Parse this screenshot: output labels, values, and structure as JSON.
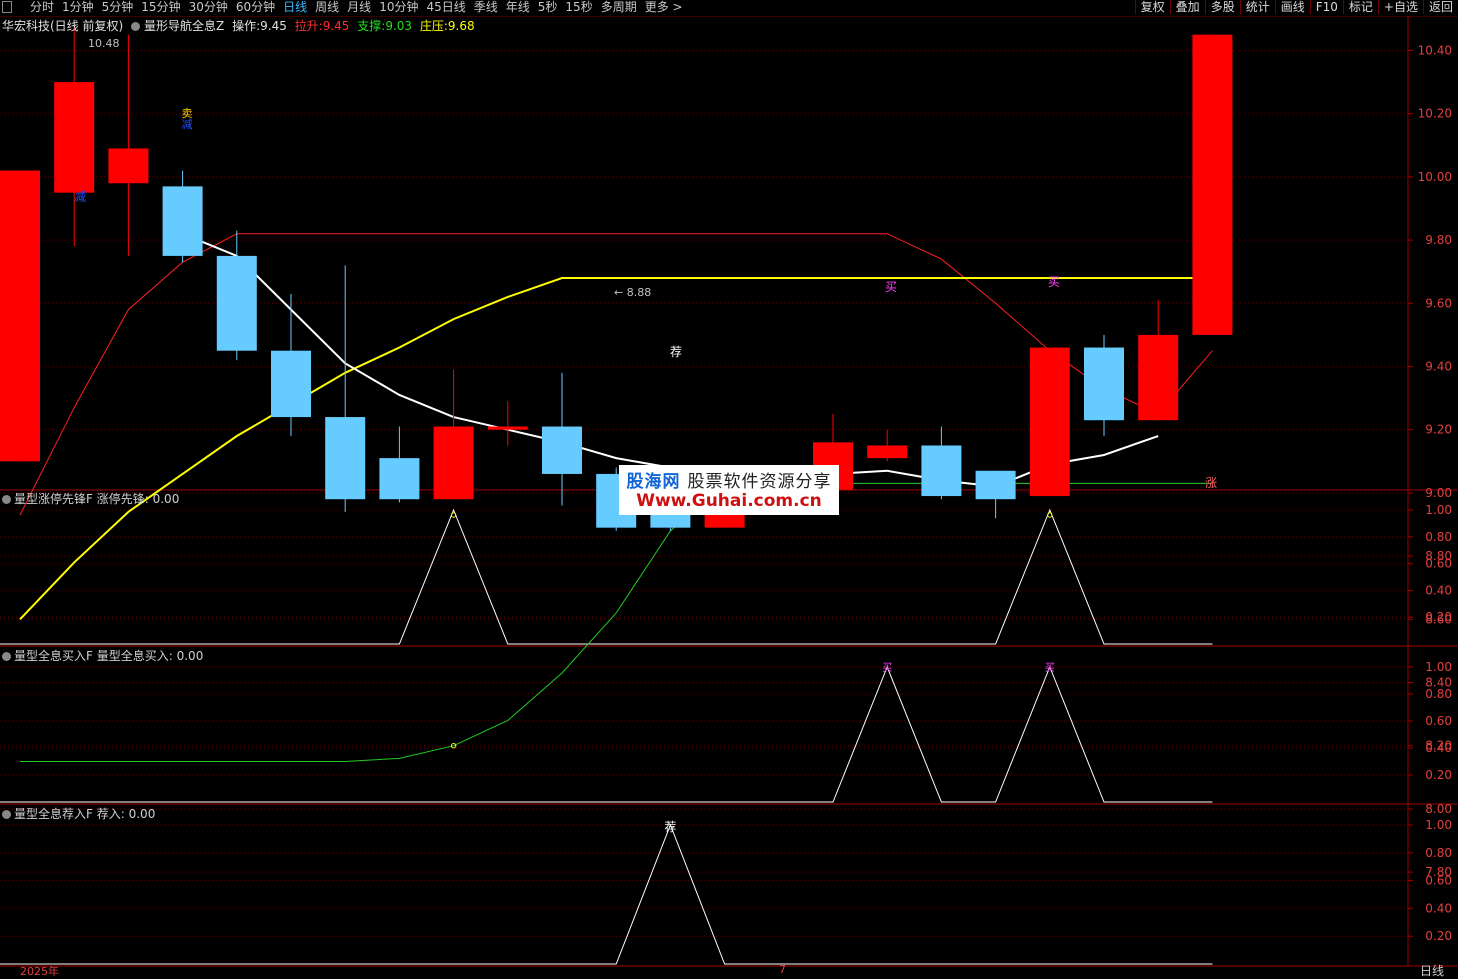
{
  "toolbar": {
    "tabs": [
      {
        "label": "分时",
        "active": false
      },
      {
        "label": "1分钟",
        "active": false
      },
      {
        "label": "5分钟",
        "active": false
      },
      {
        "label": "15分钟",
        "active": false
      },
      {
        "label": "30分钟",
        "active": false
      },
      {
        "label": "60分钟",
        "active": false
      },
      {
        "label": "日线",
        "active": true
      },
      {
        "label": "周线",
        "active": false
      },
      {
        "label": "月线",
        "active": false
      },
      {
        "label": "10分钟",
        "active": false
      },
      {
        "label": "45日线",
        "active": false
      },
      {
        "label": "季线",
        "active": false
      },
      {
        "label": "年线",
        "active": false
      },
      {
        "label": "5秒",
        "active": false
      },
      {
        "label": "15秒",
        "active": false
      },
      {
        "label": "多周期",
        "active": false
      },
      {
        "label": "更多 >",
        "active": false
      }
    ],
    "right_buttons": [
      "复权",
      "叠加",
      "多股",
      "统计",
      "画线",
      "F10",
      "标记",
      "+自选",
      "返回"
    ]
  },
  "main_legend": {
    "stock": "华宏科技(日线 前复权)",
    "indicator": "量形导航全息Z",
    "op_label": "操作:",
    "op_value": "9.45",
    "lift_label": "拉升:",
    "lift_value": "9.45",
    "support_label": "支撑:",
    "support_value": "9.03",
    "press_label": "庄压:",
    "press_value": "9.68"
  },
  "colors": {
    "up": "#ff0000",
    "down": "#66ccff",
    "bg": "#000000",
    "grid": "#5a0000",
    "white_line": "#ffffff",
    "yellow_line": "#ffff00",
    "green_line": "#22cc22",
    "pink_line": "#ff8080",
    "red_line": "#ff2020",
    "axis_text": "#e04040"
  },
  "y_axis_ticks": [
    "10.40",
    "10.20",
    "10.00",
    "9.80",
    "9.60",
    "9.40",
    "9.20",
    "9.00",
    "8.80",
    "8.60",
    "8.40",
    "8.20",
    "8.00",
    "7.80"
  ],
  "sub_axis_ticks": [
    "1.00",
    "0.80",
    "0.60",
    "0.40",
    "0.20"
  ],
  "annotations": {
    "high_price": "10.48",
    "low_price": "8.88",
    "sell_marker": "卖",
    "reduce_marker": "减",
    "reduce_marker2": "减",
    "buy_marker": "买",
    "buy_marker2": "买",
    "recommend_marker": "荐",
    "limit_up_marker": "涨"
  },
  "chart_data": {
    "type": "candlestick",
    "candles": [
      {
        "open": 9.1,
        "high": 10.02,
        "low": 9.1,
        "close": 10.02
      },
      {
        "open": 9.95,
        "high": 10.48,
        "low": 9.78,
        "close": 10.3
      },
      {
        "open": 9.98,
        "high": 10.45,
        "low": 9.75,
        "close": 10.09
      },
      {
        "open": 9.97,
        "high": 10.02,
        "low": 9.73,
        "close": 9.75
      },
      {
        "open": 9.75,
        "high": 9.83,
        "low": 9.42,
        "close": 9.45
      },
      {
        "open": 9.45,
        "high": 9.63,
        "low": 9.18,
        "close": 9.24
      },
      {
        "open": 9.24,
        "high": 9.72,
        "low": 8.94,
        "close": 8.98
      },
      {
        "open": 9.11,
        "high": 9.21,
        "low": 8.97,
        "close": 8.98
      },
      {
        "open": 8.98,
        "high": 9.39,
        "low": 8.98,
        "close": 9.21
      },
      {
        "open": 9.2,
        "high": 9.29,
        "low": 9.15,
        "close": 9.21
      },
      {
        "open": 9.21,
        "high": 9.38,
        "low": 8.96,
        "close": 9.06
      },
      {
        "open": 9.06,
        "high": 9.08,
        "low": 8.88,
        "close": 8.89
      },
      {
        "open": 8.99,
        "high": 9.01,
        "low": 8.88,
        "close": 8.89
      },
      {
        "open": 8.89,
        "high": 9.08,
        "low": 8.89,
        "close": 9.08
      },
      {
        "open": 9.01,
        "high": 9.08,
        "low": 8.96,
        "close": 9.08
      },
      {
        "open": 9.01,
        "high": 9.25,
        "low": 9.01,
        "close": 9.16
      },
      {
        "open": 9.11,
        "high": 9.2,
        "low": 9.1,
        "close": 9.15
      },
      {
        "open": 9.15,
        "high": 9.21,
        "low": 8.98,
        "close": 8.99
      },
      {
        "open": 9.07,
        "high": 9.07,
        "low": 8.92,
        "close": 8.98
      },
      {
        "open": 8.99,
        "high": 9.46,
        "low": 8.99,
        "close": 9.46
      },
      {
        "open": 9.46,
        "high": 9.5,
        "low": 9.18,
        "close": 9.23
      },
      {
        "open": 9.23,
        "high": 9.61,
        "low": 9.23,
        "close": 9.5
      },
      {
        "open": 9.5,
        "high": 10.45,
        "low": 9.5,
        "close": 10.45
      }
    ],
    "ma_white": [
      null,
      null,
      null,
      9.82,
      9.75,
      9.58,
      9.41,
      9.31,
      9.24,
      9.2,
      9.16,
      9.11,
      9.08,
      9.07,
      9.06,
      9.06,
      9.07,
      9.04,
      9.02,
      9.09,
      9.12,
      9.18,
      null
    ],
    "ma_yellow": [
      8.6,
      8.78,
      8.94,
      9.06,
      9.18,
      9.28,
      9.38,
      9.46,
      9.55,
      9.62,
      9.68,
      9.68,
      9.68,
      9.68,
      9.68,
      9.68,
      9.68,
      9.68,
      9.68,
      9.68,
      9.68,
      9.68,
      9.68
    ],
    "ma_green": [
      8.15,
      8.15,
      8.15,
      8.15,
      8.15,
      8.15,
      8.15,
      8.16,
      8.2,
      8.28,
      8.43,
      8.62,
      8.88,
      9.03,
      9.03,
      9.03,
      9.03,
      9.03,
      9.03,
      9.03,
      9.03,
      9.03,
      9.03
    ],
    "ma_red": [
      8.93,
      9.27,
      9.58,
      9.73,
      9.82,
      9.82,
      9.82,
      9.82,
      9.82,
      9.82,
      9.82,
      9.82,
      9.82,
      9.82,
      9.82,
      9.82,
      9.82,
      9.74,
      9.6,
      9.45,
      9.33,
      9.25,
      9.45
    ],
    "ylim": [
      7.65,
      10.55
    ],
    "sub_charts": [
      {
        "name": "量型涨停先锋F",
        "series": "涨停先锋",
        "value": "0.00",
        "values": [
          0,
          0,
          0,
          0,
          0,
          0,
          0,
          0,
          1,
          0,
          0,
          0,
          0,
          0,
          0,
          0,
          0,
          0,
          0,
          1,
          0,
          0,
          0
        ]
      },
      {
        "name": "量型全息买入F",
        "series": "量型全息买入",
        "value": "0.00",
        "values": [
          0,
          0,
          0,
          0,
          0,
          0,
          0,
          0,
          0,
          0,
          0,
          0,
          0,
          0,
          0,
          0,
          1,
          0,
          0,
          1,
          0,
          0,
          0
        ]
      },
      {
        "name": "量型全息荐入F",
        "series": "荐入",
        "value": "0.00",
        "values": [
          0,
          0,
          0,
          0,
          0,
          0,
          0,
          0,
          0,
          0,
          0,
          0,
          1,
          0,
          0,
          0,
          0,
          0,
          0,
          0,
          0,
          0,
          0
        ]
      }
    ]
  },
  "watermark": {
    "cn_brand": "股海网",
    "cn_tag": "股票软件资源分享",
    "url": "Www.Guhai.com.cn"
  },
  "bottom": {
    "year_label": "2025年",
    "month_label": "7",
    "period_label": "日线"
  }
}
